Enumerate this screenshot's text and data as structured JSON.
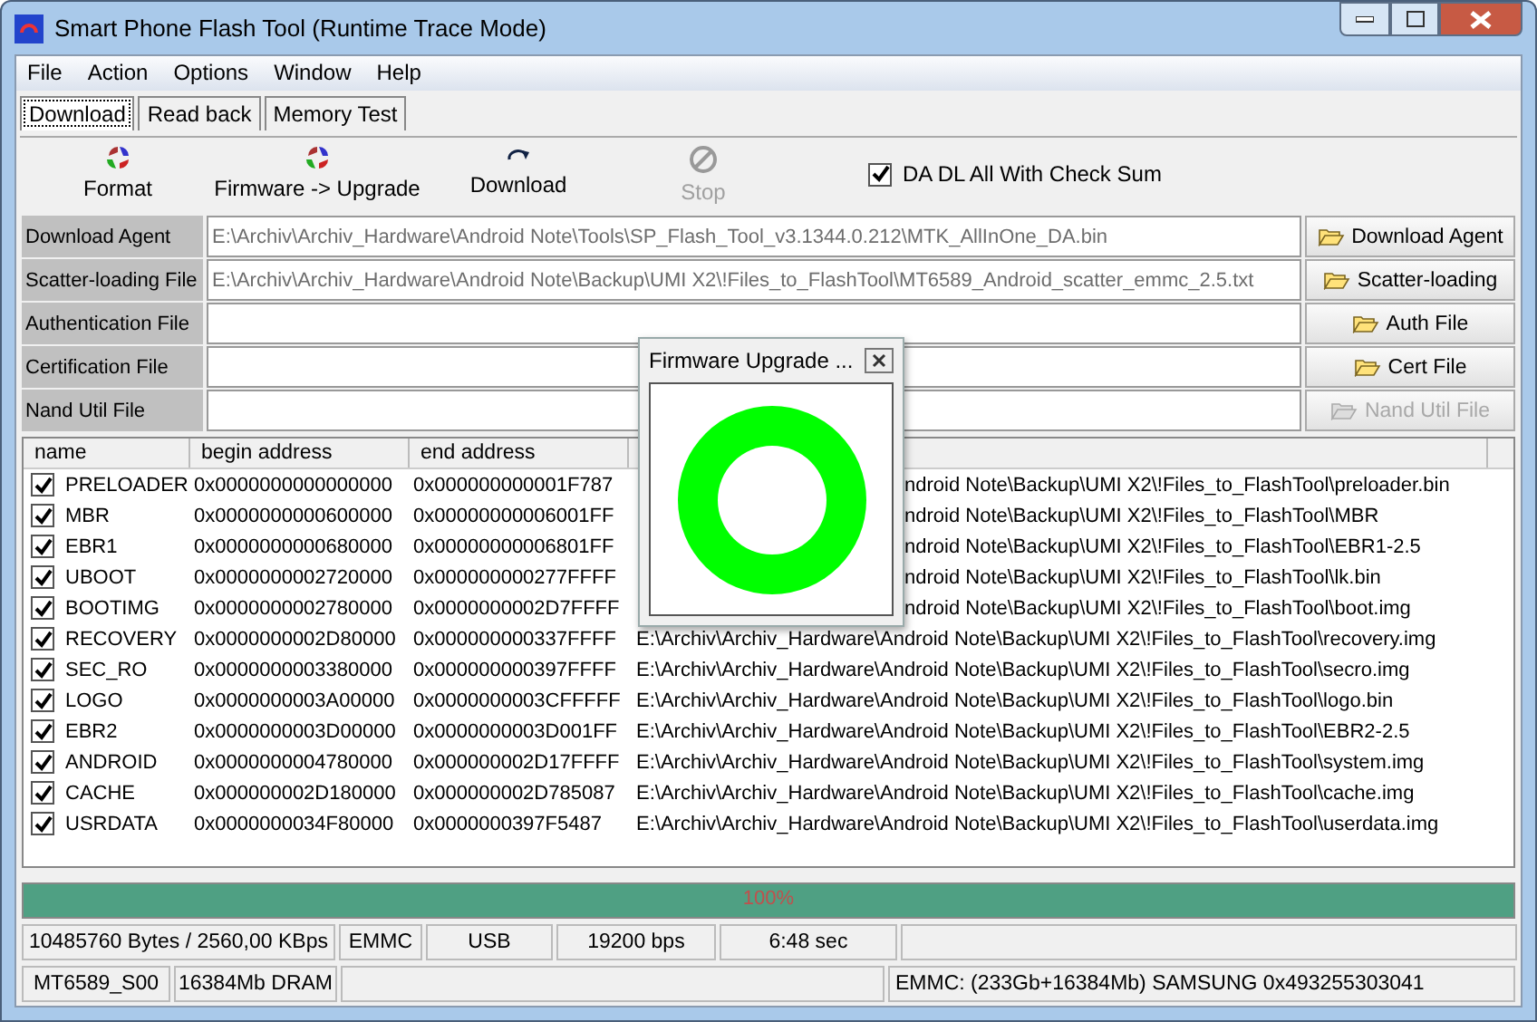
{
  "window": {
    "title": "Smart Phone Flash Tool (Runtime Trace Mode)"
  },
  "menu": [
    "File",
    "Action",
    "Options",
    "Window",
    "Help"
  ],
  "tabs": [
    {
      "label": "Download",
      "selected": true
    },
    {
      "label": "Read back",
      "selected": false
    },
    {
      "label": "Memory Test",
      "selected": false
    }
  ],
  "toolbar": [
    {
      "label": "Format",
      "kind": "cycle",
      "disabled": false
    },
    {
      "label": "Firmware -> Upgrade",
      "kind": "cycle",
      "disabled": false
    },
    {
      "label": "Download",
      "kind": "redo",
      "disabled": false
    },
    {
      "label": "Stop",
      "kind": "stop",
      "disabled": true
    }
  ],
  "checksum": {
    "label": "DA DL All With Check Sum",
    "checked": true
  },
  "files": [
    {
      "label": "Download Agent",
      "value": "E:\\Archiv\\Archiv_Hardware\\Android Note\\Tools\\SP_Flash_Tool_v3.1344.0.212\\MTK_AllInOne_DA.bin",
      "button": "Download Agent",
      "disabled": false
    },
    {
      "label": "Scatter-loading File",
      "value": "E:\\Archiv\\Archiv_Hardware\\Android Note\\Backup\\UMI X2\\!Files_to_FlashTool\\MT6589_Android_scatter_emmc_2.5.txt",
      "button": "Scatter-loading",
      "disabled": false
    },
    {
      "label": "Authentication File",
      "button": "Auth File",
      "disabled": false
    },
    {
      "label": "Certification File",
      "button": "Cert File",
      "disabled": false
    },
    {
      "label": "Nand Util File",
      "button": "Nand Util File",
      "disabled": true
    }
  ],
  "table": {
    "columns": [
      "name",
      "begin address",
      "end address"
    ],
    "rows": [
      {
        "name": "PRELOADER",
        "checked": true,
        "begin": "0x0000000000000000",
        "end": "0x000000000001F787",
        "path": "ndroid Note\\Backup\\UMI X2\\!Files_to_FlashTool\\preloader.bin",
        "covered": true
      },
      {
        "name": "MBR",
        "checked": true,
        "begin": "0x0000000000600000",
        "end": "0x00000000006001FF",
        "path": "ndroid Note\\Backup\\UMI X2\\!Files_to_FlashTool\\MBR",
        "covered": true
      },
      {
        "name": "EBR1",
        "checked": true,
        "begin": "0x0000000000680000",
        "end": "0x00000000006801FF",
        "path": "ndroid Note\\Backup\\UMI X2\\!Files_to_FlashTool\\EBR1-2.5",
        "covered": true
      },
      {
        "name": "UBOOT",
        "checked": true,
        "begin": "0x0000000002720000",
        "end": "0x000000000277FFFF",
        "path": "ndroid Note\\Backup\\UMI X2\\!Files_to_FlashTool\\lk.bin",
        "covered": true
      },
      {
        "name": "BOOTIMG",
        "checked": true,
        "begin": "0x0000000002780000",
        "end": "0x0000000002D7FFFF",
        "path": "ndroid Note\\Backup\\UMI X2\\!Files_to_FlashTool\\boot.img",
        "covered": true
      },
      {
        "name": "RECOVERY",
        "checked": true,
        "begin": "0x0000000002D80000",
        "end": "0x000000000337FFFF",
        "path": "E:\\Archiv\\Archiv_Hardware\\Android Note\\Backup\\UMI X2\\!Files_to_FlashTool\\recovery.img",
        "covered": false
      },
      {
        "name": "SEC_RO",
        "checked": true,
        "begin": "0x0000000003380000",
        "end": "0x000000000397FFFF",
        "path": "E:\\Archiv\\Archiv_Hardware\\Android Note\\Backup\\UMI X2\\!Files_to_FlashTool\\secro.img",
        "covered": false
      },
      {
        "name": "LOGO",
        "checked": true,
        "begin": "0x0000000003A00000",
        "end": "0x0000000003CFFFFF",
        "path": "E:\\Archiv\\Archiv_Hardware\\Android Note\\Backup\\UMI X2\\!Files_to_FlashTool\\logo.bin",
        "covered": false
      },
      {
        "name": "EBR2",
        "checked": true,
        "begin": "0x0000000003D00000",
        "end": "0x0000000003D001FF",
        "path": "E:\\Archiv\\Archiv_Hardware\\Android Note\\Backup\\UMI X2\\!Files_to_FlashTool\\EBR2-2.5",
        "covered": false
      },
      {
        "name": "ANDROID",
        "checked": true,
        "begin": "0x0000000004780000",
        "end": "0x000000002D17FFFF",
        "path": "E:\\Archiv\\Archiv_Hardware\\Android Note\\Backup\\UMI X2\\!Files_to_FlashTool\\system.img",
        "covered": false
      },
      {
        "name": "CACHE",
        "checked": true,
        "begin": "0x000000002D180000",
        "end": "0x000000002D785087",
        "path": "E:\\Archiv\\Archiv_Hardware\\Android Note\\Backup\\UMI X2\\!Files_to_FlashTool\\cache.img",
        "covered": false
      },
      {
        "name": "USRDATA",
        "checked": true,
        "begin": "0x0000000034F80000",
        "end": "0x0000000397F5487",
        "path": "E:\\Archiv\\Archiv_Hardware\\Android Note\\Backup\\UMI X2\\!Files_to_FlashTool\\userdata.img",
        "covered": false
      }
    ]
  },
  "progress": {
    "level": 1,
    "label": "100%"
  },
  "status_bar": [
    [
      "10485760 Bytes / 2560,00 KBps",
      "EMMC",
      "USB",
      "19200 bps",
      "6:48 sec"
    ],
    [
      "MT6589_S00",
      "16384Mb DRAM",
      "EMMC: (233Gb+16384Mb) SAMSUNG 0x493255303041"
    ]
  ],
  "dialog": {
    "title": "Firmware Upgrade ..."
  }
}
